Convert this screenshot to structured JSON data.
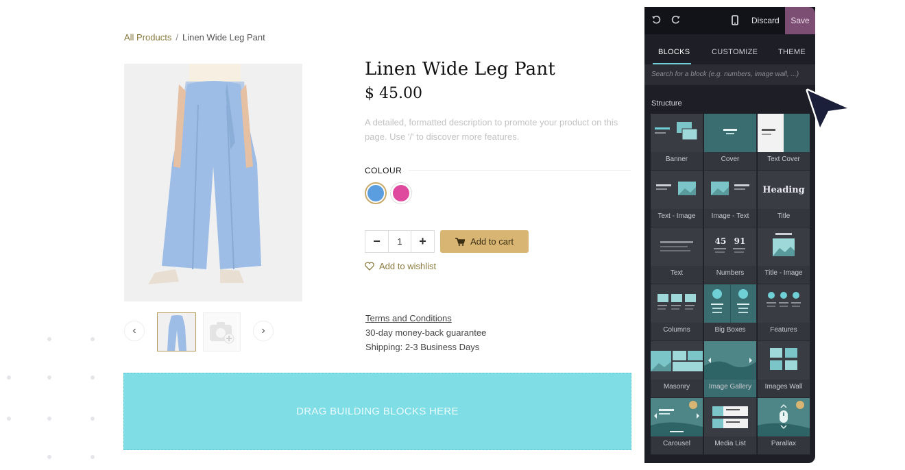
{
  "breadcrumb": {
    "root": "All Products",
    "separator": "/",
    "current": "Linen Wide Leg Pant"
  },
  "product": {
    "title": "Linen Wide Leg Pant",
    "price": "$ 45.00",
    "description": "A detailed, formatted description to promote your product on this page. Use '/' to discover more features.",
    "colour_label": "COLOUR",
    "colours": [
      "#5a9ee0",
      "#e04a9e"
    ],
    "quantity": "1",
    "minus": "−",
    "plus": "+",
    "add_to_cart": "Add to cart",
    "wishlist": "Add to wishlist",
    "terms": "Terms and Conditions",
    "guarantee": "30-day money-back guarantee",
    "shipping": "Shipping: 2-3 Business Days"
  },
  "gallery": {
    "prev": "‹",
    "next": "›"
  },
  "dropzone": {
    "text": "DRAG BUILDING BLOCKS HERE"
  },
  "editor": {
    "discard": "Discard",
    "save": "Save",
    "tabs": [
      "BLOCKS",
      "CUSTOMIZE",
      "THEME"
    ],
    "search_placeholder": "Search for a block (e.g. numbers, image wall, ...)",
    "section": "Structure",
    "blocks": [
      "Banner",
      "Cover",
      "Text Cover",
      "Text - Image",
      "Image - Text",
      "Title",
      "Text",
      "Numbers",
      "Title - Image",
      "Columns",
      "Big Boxes",
      "Features",
      "Masonry",
      "Image Gallery",
      "Images Wall",
      "Carousel",
      "Media List",
      "Parallax"
    ],
    "heading_sample": "Heading",
    "numbers_sample": [
      "45",
      "91"
    ]
  },
  "colors": {
    "accent": "#d8b572",
    "brand_link": "#8a7a3e",
    "save": "#7d4e74",
    "dropzone": "#7fdde6",
    "teal": "#3a6d6f"
  }
}
